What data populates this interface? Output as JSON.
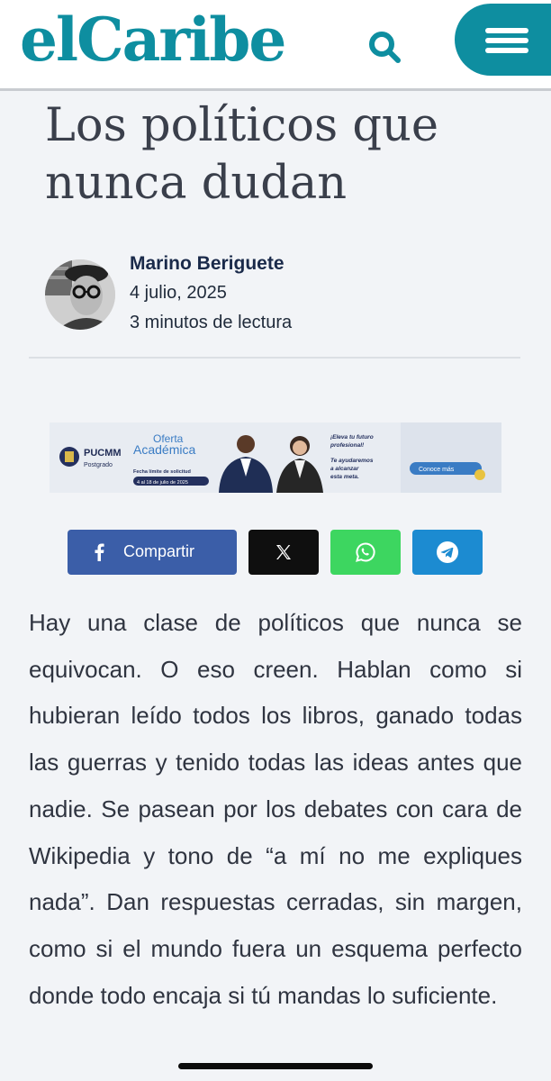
{
  "header": {
    "logo_text": "elCaribe",
    "brand_color": "#0e8ea0",
    "search_icon": "search-icon",
    "menu_icon": "hamburger-menu-icon"
  },
  "article": {
    "title": "Los políticos que nunca dudan",
    "author": {
      "name": "Marino Beriguete",
      "date": "4 julio, 2025",
      "reading_time": "3 minutos de lectura"
    },
    "share": {
      "facebook_label": "Compartir",
      "facebook_color": "#3b5ea8",
      "x_color": "#0f0f0f",
      "whatsapp_color": "#3dd660",
      "telegram_color": "#1c8bd1"
    },
    "body": "Hay una clase de políticos que nunca se equivocan. O eso creen. Hablan como si hubieran leído todos los libros, ganado todas las guerras y tenido todas las ideas antes que nadie. Se pasean por los debates con cara de Wikipedia y tono de “a mí no me expliques nada”. Dan respuestas cerradas, sin margen, como si el mundo fuera un esquema perfecto donde todo encaja si tú mandas lo suficiente."
  },
  "ad": {
    "brand": "PUCMM",
    "brand_sub": "Postgrado",
    "headline_1": "Oferta",
    "headline_2": "Académica",
    "deadline_line_1": "Fecha límite de solicitud",
    "deadline_line_2": "4 al 18 de julio de 2025",
    "tagline_1": "¡Eleva tu futuro",
    "tagline_2": "profesional!",
    "tagline_3": "Te ayudaremos",
    "tagline_4": "a alcanzar",
    "tagline_5": "esta meta.",
    "cta": "Conoce más"
  }
}
